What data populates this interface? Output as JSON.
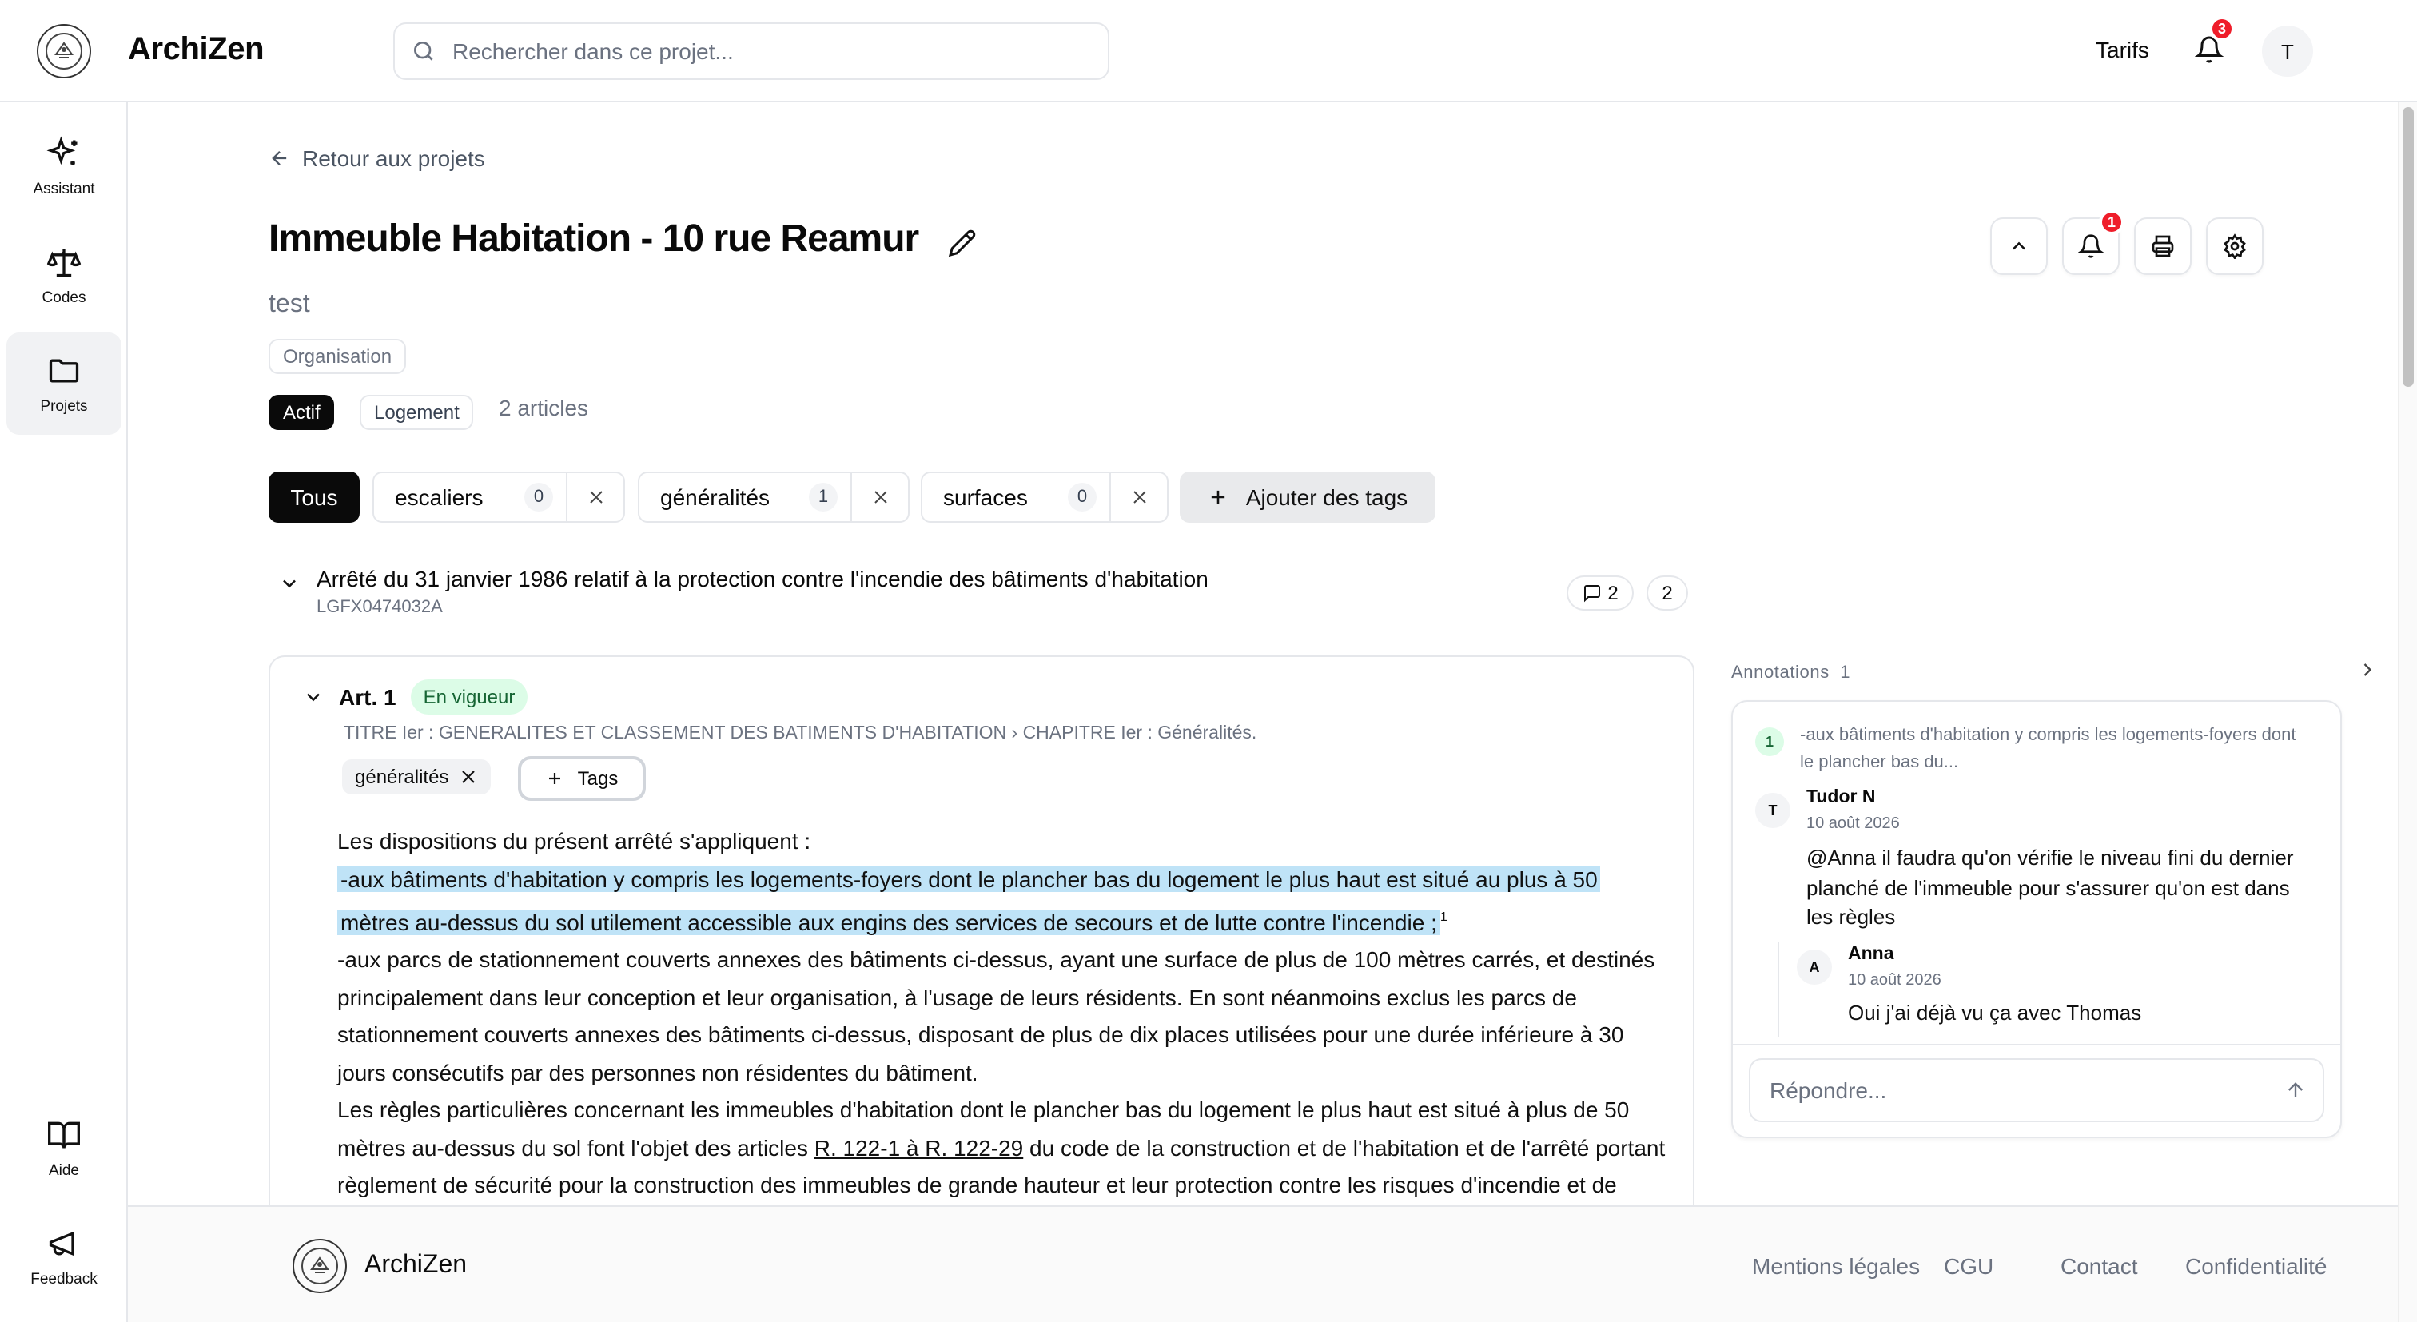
{
  "app": {
    "brand": "ArchiZen"
  },
  "header": {
    "search_placeholder": "Rechercher dans ce projet...",
    "tarifs": "Tarifs",
    "notifications_count": "3",
    "avatar_initial": "T"
  },
  "sidebar": {
    "items": [
      {
        "label": "Assistant",
        "icon": "sparkles-icon"
      },
      {
        "label": "Codes",
        "icon": "scale-icon"
      },
      {
        "label": "Projets",
        "icon": "folder-icon"
      },
      {
        "label": "Aide",
        "icon": "book-open-icon"
      },
      {
        "label": "Feedback",
        "icon": "megaphone-icon"
      }
    ],
    "active": "Projets"
  },
  "project": {
    "back_label": "Retour aux projets",
    "title": "Immeuble Habitation - 10 rue Reamur",
    "description": "test",
    "organisation_chip": "Organisation",
    "status_chip": "Actif",
    "type_chip": "Logement",
    "articles_count": "2 articles",
    "notif_count": "1"
  },
  "tag_filters": {
    "all_label": "Tous",
    "tags": [
      {
        "label": "escaliers",
        "count": "0"
      },
      {
        "label": "généralités",
        "count": "1"
      },
      {
        "label": "surfaces",
        "count": "0"
      }
    ],
    "add_label": "Ajouter des tags"
  },
  "law": {
    "title": "Arrêté du 31 janvier 1986 relatif à la protection contre l'incendie des bâtiments d'habitation",
    "code": "LGFX0474032A",
    "comments_count": "2",
    "articles_count": "2"
  },
  "article": {
    "label": "Art. 1",
    "status": "En vigueur",
    "breadcrumb": "TITRE Ier : GENERALITES ET CLASSEMENT DES BATIMENTS D'HABITATION › CHAPITRE Ier : Généralités.",
    "tag": "généralités",
    "add_tag_label": "Tags",
    "intro": "Les dispositions du présent arrêté s'appliquent :",
    "highlighted": "-aux bâtiments d'habitation y compris les logements-foyers dont le plancher bas du logement le plus haut est situé au plus à 50 mètres au-dessus du sol utilement accessible aux engins des services de secours et de lutte contre l'incendie ;",
    "highlight_ref": "1",
    "para2": "-aux parcs de stationnement couverts annexes des bâtiments ci-dessus, ayant une surface de plus de 100 mètres carrés, et destinés principalement dans leur conception et leur organisation, à l'usage de leurs résidents. En sont néanmoins exclus les parcs de stationnement couverts annexes des bâtiments ci-dessus, disposant de plus de dix places utilisées pour une durée inférieure à 30 jours consécutifs par des personnes non résidentes du bâtiment.",
    "para3_start": "Les règles particulières concernant les immeubles d'habitation dont le plancher bas du logement le plus haut est situé à plus de 50 mètres au-dessus du sol font l'objet des articles ",
    "para3_link": "R. 122-1 à R. 122-29",
    "para3_end": " du code de la construction et de l'habitation et de l'arrêté portant règlement de sécurité pour la construction des immeubles de grande hauteur et leur protection contre les risques d'incendie et de panique."
  },
  "annotations": {
    "header": "Annotations",
    "count": "1",
    "number": "1",
    "quote": "-aux bâtiments d'habitation y compris les logements-foyers dont le plancher bas du...",
    "comments": [
      {
        "initial": "T",
        "author": "Tudor N",
        "date": "10 août 2026",
        "text": "@Anna il faudra qu'on vérifie le niveau fini du dernier planché de l'immeuble pour s'assurer qu'on est dans les règles"
      },
      {
        "initial": "A",
        "author": "Anna",
        "date": "10 août 2026",
        "text": "Oui j'ai déjà vu ça avec Thomas"
      }
    ],
    "reply_placeholder": "Répondre..."
  },
  "footer": {
    "brand": "ArchiZen",
    "links": [
      "Mentions légales",
      "CGU",
      "Contact",
      "Confidentialité"
    ]
  }
}
